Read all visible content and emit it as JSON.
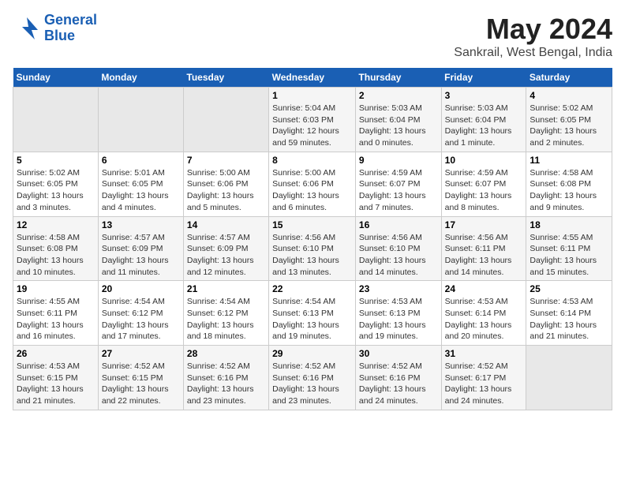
{
  "header": {
    "logo_line1": "General",
    "logo_line2": "Blue",
    "title": "May 2024",
    "subtitle": "Sankrail, West Bengal, India"
  },
  "days_of_week": [
    "Sunday",
    "Monday",
    "Tuesday",
    "Wednesday",
    "Thursday",
    "Friday",
    "Saturday"
  ],
  "weeks": [
    [
      {
        "day": "",
        "empty": true
      },
      {
        "day": "",
        "empty": true
      },
      {
        "day": "",
        "empty": true
      },
      {
        "day": "1",
        "sunrise": "5:04 AM",
        "sunset": "6:03 PM",
        "daylight": "12 hours and 59 minutes."
      },
      {
        "day": "2",
        "sunrise": "5:03 AM",
        "sunset": "6:04 PM",
        "daylight": "13 hours and 0 minutes."
      },
      {
        "day": "3",
        "sunrise": "5:03 AM",
        "sunset": "6:04 PM",
        "daylight": "13 hours and 1 minute."
      },
      {
        "day": "4",
        "sunrise": "5:02 AM",
        "sunset": "6:05 PM",
        "daylight": "13 hours and 2 minutes."
      }
    ],
    [
      {
        "day": "5",
        "sunrise": "5:02 AM",
        "sunset": "6:05 PM",
        "daylight": "13 hours and 3 minutes."
      },
      {
        "day": "6",
        "sunrise": "5:01 AM",
        "sunset": "6:05 PM",
        "daylight": "13 hours and 4 minutes."
      },
      {
        "day": "7",
        "sunrise": "5:00 AM",
        "sunset": "6:06 PM",
        "daylight": "13 hours and 5 minutes."
      },
      {
        "day": "8",
        "sunrise": "5:00 AM",
        "sunset": "6:06 PM",
        "daylight": "13 hours and 6 minutes."
      },
      {
        "day": "9",
        "sunrise": "4:59 AM",
        "sunset": "6:07 PM",
        "daylight": "13 hours and 7 minutes."
      },
      {
        "day": "10",
        "sunrise": "4:59 AM",
        "sunset": "6:07 PM",
        "daylight": "13 hours and 8 minutes."
      },
      {
        "day": "11",
        "sunrise": "4:58 AM",
        "sunset": "6:08 PM",
        "daylight": "13 hours and 9 minutes."
      }
    ],
    [
      {
        "day": "12",
        "sunrise": "4:58 AM",
        "sunset": "6:08 PM",
        "daylight": "13 hours and 10 minutes."
      },
      {
        "day": "13",
        "sunrise": "4:57 AM",
        "sunset": "6:09 PM",
        "daylight": "13 hours and 11 minutes."
      },
      {
        "day": "14",
        "sunrise": "4:57 AM",
        "sunset": "6:09 PM",
        "daylight": "13 hours and 12 minutes."
      },
      {
        "day": "15",
        "sunrise": "4:56 AM",
        "sunset": "6:10 PM",
        "daylight": "13 hours and 13 minutes."
      },
      {
        "day": "16",
        "sunrise": "4:56 AM",
        "sunset": "6:10 PM",
        "daylight": "13 hours and 14 minutes."
      },
      {
        "day": "17",
        "sunrise": "4:56 AM",
        "sunset": "6:11 PM",
        "daylight": "13 hours and 14 minutes."
      },
      {
        "day": "18",
        "sunrise": "4:55 AM",
        "sunset": "6:11 PM",
        "daylight": "13 hours and 15 minutes."
      }
    ],
    [
      {
        "day": "19",
        "sunrise": "4:55 AM",
        "sunset": "6:11 PM",
        "daylight": "13 hours and 16 minutes."
      },
      {
        "day": "20",
        "sunrise": "4:54 AM",
        "sunset": "6:12 PM",
        "daylight": "13 hours and 17 minutes."
      },
      {
        "day": "21",
        "sunrise": "4:54 AM",
        "sunset": "6:12 PM",
        "daylight": "13 hours and 18 minutes."
      },
      {
        "day": "22",
        "sunrise": "4:54 AM",
        "sunset": "6:13 PM",
        "daylight": "13 hours and 19 minutes."
      },
      {
        "day": "23",
        "sunrise": "4:53 AM",
        "sunset": "6:13 PM",
        "daylight": "13 hours and 19 minutes."
      },
      {
        "day": "24",
        "sunrise": "4:53 AM",
        "sunset": "6:14 PM",
        "daylight": "13 hours and 20 minutes."
      },
      {
        "day": "25",
        "sunrise": "4:53 AM",
        "sunset": "6:14 PM",
        "daylight": "13 hours and 21 minutes."
      }
    ],
    [
      {
        "day": "26",
        "sunrise": "4:53 AM",
        "sunset": "6:15 PM",
        "daylight": "13 hours and 21 minutes."
      },
      {
        "day": "27",
        "sunrise": "4:52 AM",
        "sunset": "6:15 PM",
        "daylight": "13 hours and 22 minutes."
      },
      {
        "day": "28",
        "sunrise": "4:52 AM",
        "sunset": "6:16 PM",
        "daylight": "13 hours and 23 minutes."
      },
      {
        "day": "29",
        "sunrise": "4:52 AM",
        "sunset": "6:16 PM",
        "daylight": "13 hours and 23 minutes."
      },
      {
        "day": "30",
        "sunrise": "4:52 AM",
        "sunset": "6:16 PM",
        "daylight": "13 hours and 24 minutes."
      },
      {
        "day": "31",
        "sunrise": "4:52 AM",
        "sunset": "6:17 PM",
        "daylight": "13 hours and 24 minutes."
      },
      {
        "day": "",
        "empty": true
      }
    ]
  ]
}
